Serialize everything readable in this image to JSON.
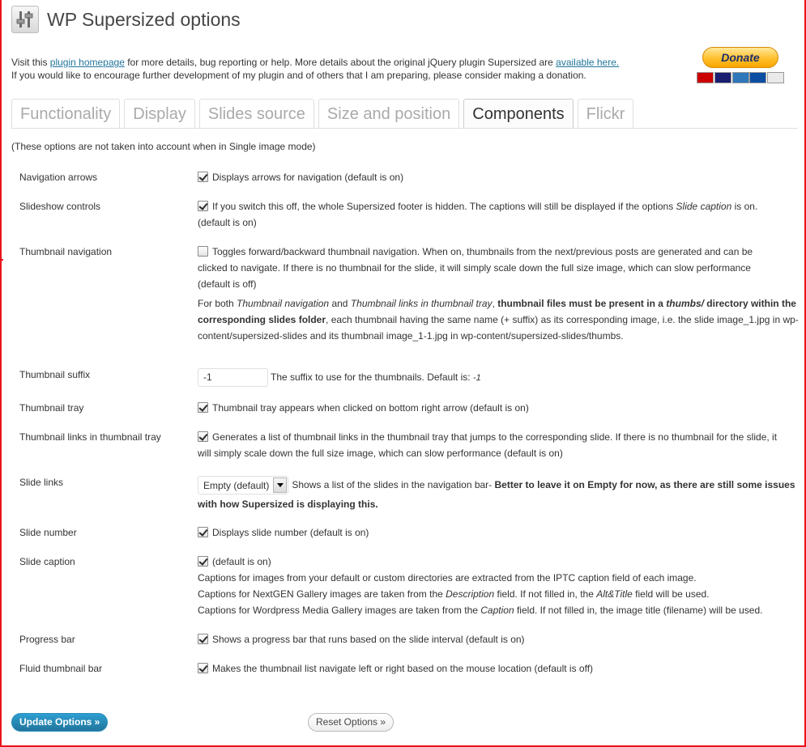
{
  "page": {
    "title": "WP Supersized options",
    "colors": {
      "frame": "#e8141b",
      "link": "#21759b",
      "primary_button": "#21759b"
    }
  },
  "intro": {
    "line1_before": "Visit this ",
    "line1_link1": "plugin homepage",
    "line1_middle": " for more details, bug reporting or help. More details about the original jQuery plugin Supersized are ",
    "line1_link2": "available here.",
    "line2": "If you would like to encourage further development of my plugin and of others that I am preparing, please consider making a donation."
  },
  "donate": {
    "label": "Donate",
    "cards": [
      "MasterCard",
      "VISA",
      "AMEX",
      "JCB",
      "BANK"
    ]
  },
  "tabs": [
    {
      "label": "Functionality",
      "active": false
    },
    {
      "label": "Display",
      "active": false
    },
    {
      "label": "Slides source",
      "active": false
    },
    {
      "label": "Size and position",
      "active": false
    },
    {
      "label": "Components",
      "active": true
    },
    {
      "label": "Flickr",
      "active": false
    }
  ],
  "note": "(These options are not taken into account when in Single image mode)",
  "rows": {
    "navigation_arrows": {
      "label": "Navigation arrows",
      "checked": true,
      "desc": "Displays arrows for navigation (default is on)"
    },
    "slideshow_controls": {
      "label": "Slideshow controls",
      "checked": true,
      "desc_a": "If you switch this off, the whole Supersized footer is hidden. The captions will still be displayed if the options ",
      "desc_em": "Slide caption",
      "desc_b": " is on.",
      "desc_c": "(default is on)"
    },
    "thumbnail_navigation": {
      "label": "Thumbnail navigation",
      "checked": false,
      "desc_l1": "Toggles forward/backward thumbnail navigation. When on, thumbnails from the next/previous posts are generated and can be",
      "desc_l2": "clicked to navigate. If there is no thumbnail for the slide, it will simply scale down the full size image, which can slow performance",
      "desc_l3": "(default is off)",
      "note_a": "For both ",
      "note_em1": "Thumbnail navigation",
      "note_b": " and ",
      "note_em2": "Thumbnail links in thumbnail tray",
      "note_c": ", ",
      "note_strong1": "thumbnail files must be present in a ",
      "note_strong_em": "thumbs/",
      "note_strong2": " directory within the corresponding slides folder",
      "note_d": ", each thumbnail having the same name (+ suffix) as its corresponding image, i.e. the slide image_1.jpg in wp-content/supersized-slides and its thumbnail image_1-1.jpg in wp-content/supersized-slides/thumbs."
    },
    "thumbnail_suffix": {
      "label": "Thumbnail suffix",
      "value": "-1",
      "desc": "The suffix to use for the thumbnails. Default is: ",
      "default_value": "-1"
    },
    "thumbnail_tray": {
      "label": "Thumbnail tray",
      "checked": true,
      "desc": "Thumbnail tray appears when clicked on bottom right arrow (default is on)"
    },
    "thumbnail_links": {
      "label": "Thumbnail links in thumbnail tray",
      "checked": true,
      "desc_l1": "Generates a list of thumbnail links in the thumbnail tray that jumps to the corresponding slide. If there is no thumbnail for the slide, it",
      "desc_l2": "will simply scale down the full size image, which can slow performance (default is on)"
    },
    "slide_links": {
      "label": "Slide links",
      "selected": "Empty (default)",
      "desc": "Shows a list of the slides in the navigation bar- ",
      "desc_strong_l1": "Better to leave it on Empty for now, as there are still some issues",
      "desc_strong_l2": "with how Supersized is displaying this."
    },
    "slide_number": {
      "label": "Slide number",
      "checked": true,
      "desc": "Displays slide number (default is on)"
    },
    "slide_caption": {
      "label": "Slide caption",
      "checked": true,
      "desc": "(default is on)",
      "l1": "Captions for images from your default or custom directories are extracted from the IPTC caption field of each image.",
      "l2_a": "Captions for NextGEN Gallery images are taken from the ",
      "l2_em1": "Description",
      "l2_b": " field. If not filled in, the ",
      "l2_em2": "Alt&Title",
      "l2_c": " field will be used.",
      "l3_a": "Captions for Wordpress Media Gallery images are taken from the ",
      "l3_em": "Caption",
      "l3_b": " field. If not filled in, the image title (filename) will be used."
    },
    "progress_bar": {
      "label": "Progress bar",
      "checked": true,
      "desc": "Shows a progress bar that runs based on the slide interval (default is on)"
    },
    "fluid_thumbnail_bar": {
      "label": "Fluid thumbnail bar",
      "checked": true,
      "desc": "Makes the thumbnail list navigate left or right based on the mouse location (default is off)"
    }
  },
  "buttons": {
    "update": "Update Options »",
    "reset": "Reset Options »"
  },
  "icons": {
    "logo": "settings-sliders-icon",
    "dropdown": "chevron-down-icon"
  }
}
